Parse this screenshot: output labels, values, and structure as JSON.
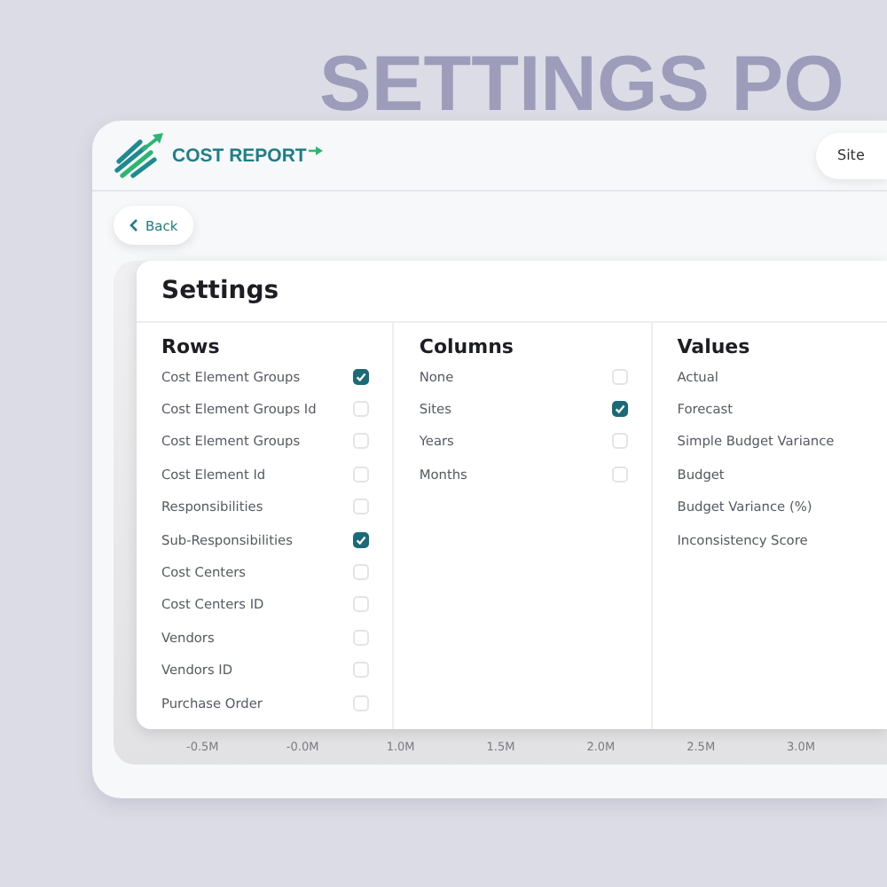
{
  "backdrop_title": "SETTINGS PO",
  "header": {
    "logo_text": "COST REPORT",
    "site_button": "Site"
  },
  "back_button": "Back",
  "settings": {
    "title": "Settings",
    "groups": [
      {
        "kind": "checklist",
        "heading": "Rows",
        "items": [
          {
            "label": "Cost Element Groups",
            "checked": true
          },
          {
            "label": "Cost Element Groups Id",
            "checked": false
          },
          {
            "label": "Cost Element Groups",
            "checked": false
          },
          {
            "label": "Cost Element Id",
            "checked": false
          },
          {
            "label": "Responsibilities",
            "checked": false
          },
          {
            "label": "Sub-Responsibilities",
            "checked": true
          },
          {
            "label": "Cost Centers",
            "checked": false
          },
          {
            "label": "Cost Centers ID",
            "checked": false
          },
          {
            "label": "Vendors",
            "checked": false
          },
          {
            "label": "Vendors ID",
            "checked": false
          },
          {
            "label": "Purchase Order",
            "checked": false
          }
        ]
      },
      {
        "kind": "checklist",
        "heading": "Columns",
        "items": [
          {
            "label": "None",
            "checked": false
          },
          {
            "label": "Sites",
            "checked": true
          },
          {
            "label": "Years",
            "checked": false
          },
          {
            "label": "Months",
            "checked": false
          }
        ]
      },
      {
        "kind": "list",
        "heading": "Values",
        "items": [
          {
            "label": "Actual"
          },
          {
            "label": "Forecast"
          },
          {
            "label": "Simple Budget Variance"
          },
          {
            "label": "Budget"
          },
          {
            "label": "Budget Variance (%)"
          },
          {
            "label": "Inconsistency Score"
          }
        ]
      }
    ]
  },
  "chart_axis_labels": [
    "-0.5M",
    "-0.0M",
    "1.0M",
    "1.5M",
    "2.0M",
    "2.5M",
    "3.0M"
  ]
}
